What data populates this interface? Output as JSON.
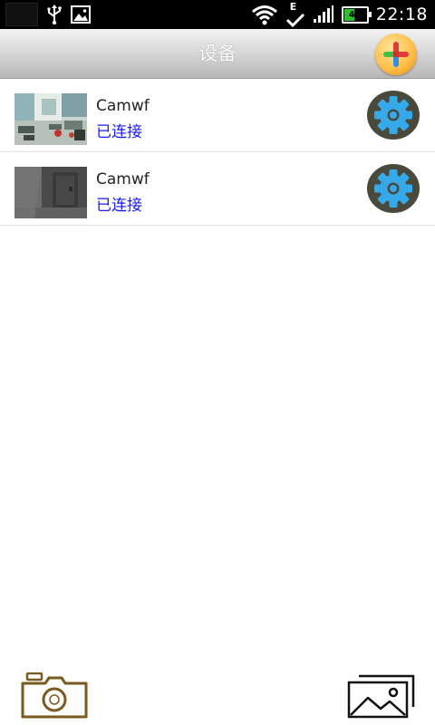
{
  "status_bar": {
    "time": "22:18",
    "battery_level": "43",
    "network_letter": "E"
  },
  "header": {
    "title": "设备"
  },
  "devices": [
    {
      "name": "Camwf",
      "status": "已连接",
      "status_color": "#1a1aff"
    },
    {
      "name": "Camwf",
      "status": "已连接",
      "status_color": "#1a1aff"
    }
  ],
  "icons": {
    "add": "add-device-icon",
    "settings": "gear-icon",
    "camera": "camera-icon",
    "gallery": "gallery-icon"
  },
  "colors": {
    "gear_blue": "#35a9ea",
    "gear_bg": "#4a4a3c",
    "add_gold": "#ffc04a",
    "camera_outline": "#7a5a1e"
  }
}
